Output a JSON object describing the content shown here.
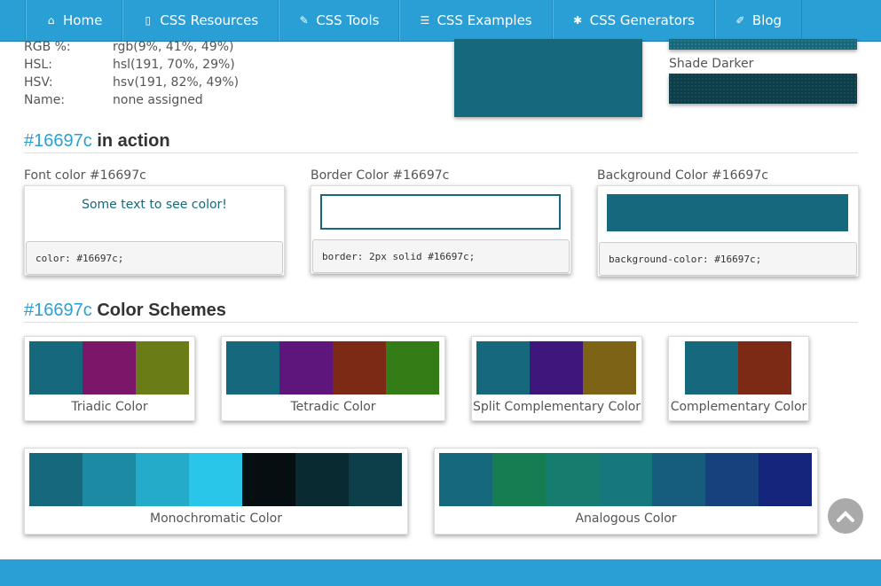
{
  "nav": [
    {
      "label": "Home",
      "icon": "home-icon",
      "glyph": "⌂"
    },
    {
      "label": "CSS Resources",
      "icon": "file-icon",
      "glyph": "▯"
    },
    {
      "label": "CSS Tools",
      "icon": "wrench-icon",
      "glyph": "✎"
    },
    {
      "label": "CSS Examples",
      "icon": "list-icon",
      "glyph": "☰"
    },
    {
      "label": "CSS Generators",
      "icon": "gear-icon",
      "glyph": "✱"
    },
    {
      "label": "Blog",
      "icon": "pencil-icon",
      "glyph": "✐"
    }
  ],
  "info": [
    {
      "label": "RGB %:",
      "value": "rgb(9%, 41%, 49%)"
    },
    {
      "label": "HSL:",
      "value": "hsl(191, 70%, 29%)"
    },
    {
      "label": "HSV:",
      "value": "hsv(191, 82%, 49%)"
    },
    {
      "label": "Name:",
      "value": "none assigned"
    }
  ],
  "shades": {
    "darker_label": "Shade Darker"
  },
  "action": {
    "hex": "#16697c",
    "title": "in action",
    "font": {
      "label": "Font color #16697c",
      "sample": "Some text to see color!",
      "code": "color: #16697c;"
    },
    "border": {
      "label": "Border Color #16697c",
      "code": "border: 2px solid #16697c;"
    },
    "background": {
      "label": "Background Color #16697c",
      "code": "background-color: #16697c;"
    }
  },
  "schemes_heading": {
    "hex": "#16697c",
    "title": "Color Schemes"
  },
  "schemes": [
    {
      "name": "Triadic Color",
      "colors": [
        "#16697c",
        "#7c1669",
        "#697c16"
      ]
    },
    {
      "name": "Tetradic Color",
      "colors": [
        "#16697c",
        "#5e167c",
        "#7c2916",
        "#347c16"
      ]
    },
    {
      "name": "Split Complementary Color",
      "colors": [
        "#16697c",
        "#3e167c",
        "#7c6316"
      ]
    },
    {
      "name": "Complementary Color",
      "colors": [
        "#16697c",
        "#7c2916"
      ]
    },
    {
      "name": "Monochromatic Color",
      "colors": [
        "#16697c",
        "#1d8aa3",
        "#24abca",
        "#29c6ea",
        "#050e10",
        "#0a2a32",
        "#0d3f4a"
      ]
    },
    {
      "name": "Analogous Color",
      "colors": [
        "#16697c",
        "#167c52",
        "#167c6e",
        "#16787c",
        "#165c7c",
        "#16417c",
        "#16257c"
      ]
    }
  ],
  "colors": {
    "accent": "#2a9fd6",
    "base": "#16697c"
  }
}
